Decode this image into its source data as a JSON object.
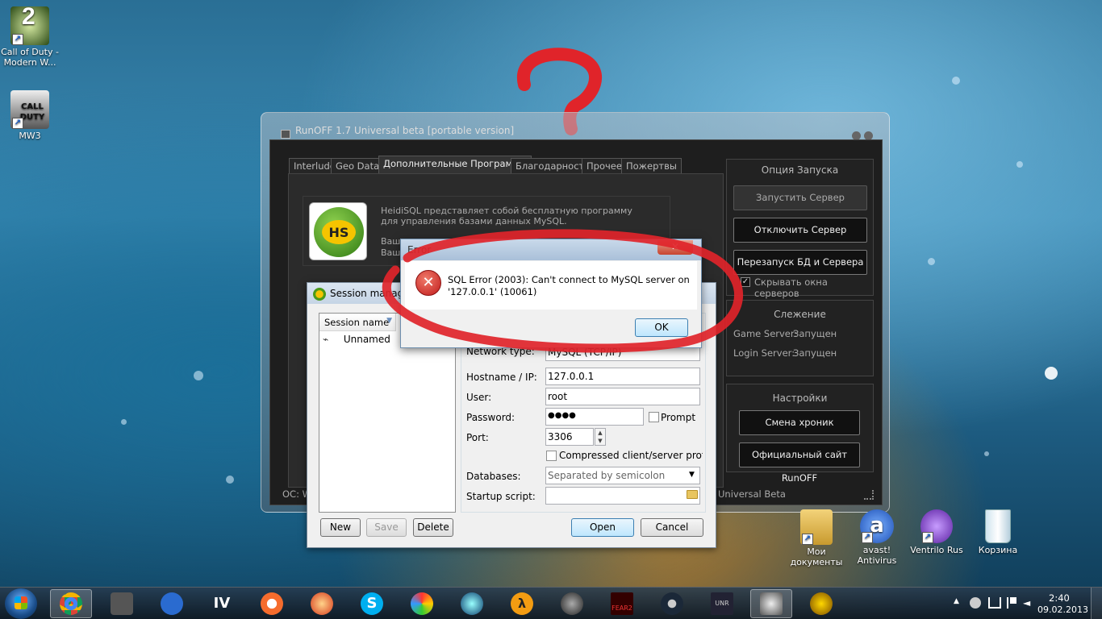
{
  "desktop": {
    "icons_left": [
      {
        "label": "Call of Duty - Modern W...",
        "icon": "cod-mw2-icon"
      },
      {
        "label": "MW3",
        "icon": "cod-mw3-icon"
      }
    ],
    "icons_bottom": [
      {
        "label": "Мои документы",
        "icon": "my-documents-icon"
      },
      {
        "label": "avast! Antivirus",
        "icon": "avast-icon"
      },
      {
        "label": "Ventrilo Rus",
        "icon": "ventrilo-icon"
      },
      {
        "label": "Корзина",
        "icon": "recycle-bin-icon"
      }
    ],
    "annotation": "?"
  },
  "runoff": {
    "title": "RunOFF 1.7 Universal beta [portable version]",
    "tabs": [
      "Interlude",
      "Geo Data",
      "Дополнительные Программы",
      "Благодарности",
      "Прочее",
      "Пожертвы"
    ],
    "active_tab": 2,
    "heidi_desc": "HeidiSQL представляет собой бесплатную программу для управления базами данных MySQL.",
    "heidi_partial_1": "Ваш",
    "heidi_partial_2": "Ваш",
    "heidi_logo": "HS",
    "launch": {
      "header": "Опция Запуска",
      "start": "Запустить Сервер",
      "stop": "Отключить Сервер",
      "restart": "Перезапуск БД и Сервера",
      "hide": "Скрывать окна серверов"
    },
    "monitor": {
      "header": "Слежение",
      "game_label": "Game Server:",
      "game_status": "Запущен",
      "login_label": "Login Server:",
      "login_status": "Запущен"
    },
    "settings": {
      "header": "Настройки",
      "chronicles": "Смена хроник",
      "site": "Официальный сайт RunOFF"
    },
    "status_left": "ОС: W",
    "status_right": "Universal Beta"
  },
  "session": {
    "title": "Session manager",
    "col_header": "Session name",
    "item": "Unnamed",
    "labels": {
      "network": "Network type:",
      "host": "Hostname / IP:",
      "user": "User:",
      "password": "Password:",
      "port": "Port:",
      "compressed": "Compressed client/server protocol",
      "databases": "Databases:",
      "startup": "Startup script:",
      "prompt": "Prompt"
    },
    "values": {
      "network": "MySQL (TCP/IP)",
      "host": "127.0.0.1",
      "user": "root",
      "password": "●●●●",
      "port": "3306",
      "databases": "Separated by semicolon"
    },
    "buttons": {
      "new": "New",
      "save": "Save",
      "delete": "Delete",
      "open": "Open",
      "cancel": "Cancel"
    }
  },
  "error": {
    "title": "Error",
    "message_1": "SQL Error (2003): Can't connect to MySQL server on",
    "message_2": "'127.0.0.1' (10061)",
    "ok": "OK"
  },
  "tray": {
    "time": "2:40",
    "date": "09.02.2013"
  },
  "taskbar_apps": [
    "chrome-icon",
    "world-of-tanks-icon",
    "moon-app-icon",
    "gta-iv-icon",
    "origin-icon",
    "ccleaner-icon",
    "skype-icon",
    "paint-icon",
    "media-icon",
    "half-life-2-icon",
    "ventrilo-icon",
    "fear2-icon",
    "steam-icon",
    "unreal-icon",
    "runoff-icon",
    "wow-icon"
  ],
  "taskbar_labels": {
    "gta": "IV",
    "hl2": "λ",
    "fear": "FEAR2",
    "unreal": "UNR"
  }
}
